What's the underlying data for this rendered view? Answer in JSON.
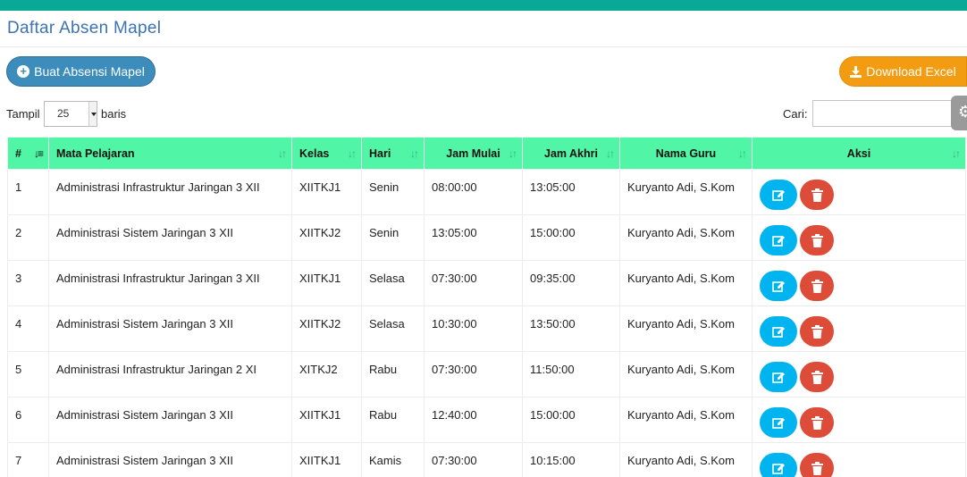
{
  "page": {
    "title": "Daftar Absen Mapel"
  },
  "toolbar": {
    "create_label": "Buat Absensi Mapel",
    "excel_label": "Download Excel",
    "accent": "#3c8dbc",
    "excel_color": "#f39c12",
    "header_bar_color": "#0aa896"
  },
  "table_controls": {
    "length_prefix": "Tampil",
    "length_value": "25",
    "length_suffix": "baris",
    "search_label": "Cari:",
    "search_value": ""
  },
  "table": {
    "header_color": "#50f5a6",
    "columns": [
      "#",
      "Mata Pelajaran",
      "Kelas",
      "Hari",
      "Jam Mulai",
      "Jam Akhri",
      "Nama Guru",
      "Aksi"
    ],
    "rows": [
      [
        "1",
        "Administrasi Infrastruktur Jaringan 3 XII",
        "XIITKJ1",
        "Senin",
        "08:00:00",
        "13:05:00",
        "Kuryanto Adi, S.Kom"
      ],
      [
        "2",
        "Administrasi Sistem Jaringan 3 XII",
        "XIITKJ2",
        "Senin",
        "13:05:00",
        "15:00:00",
        "Kuryanto Adi, S.Kom"
      ],
      [
        "3",
        "Administrasi Infrastruktur Jaringan 3 XII",
        "XIITKJ1",
        "Selasa",
        "07:30:00",
        "09:35:00",
        "Kuryanto Adi, S.Kom"
      ],
      [
        "4",
        "Administrasi Sistem Jaringan 3 XII",
        "XIITKJ2",
        "Selasa",
        "10:30:00",
        "13:50:00",
        "Kuryanto Adi, S.Kom"
      ],
      [
        "5",
        "Administrasi Infrastruktur Jaringan 2 XI",
        "XITKJ2",
        "Rabu",
        "07:30:00",
        "11:50:00",
        "Kuryanto Adi, S.Kom"
      ],
      [
        "6",
        "Administrasi Sistem Jaringan 3 XII",
        "XIITKJ1",
        "Rabu",
        "12:40:00",
        "15:00:00",
        "Kuryanto Adi, S.Kom"
      ],
      [
        "7",
        "Administrasi Sistem Jaringan 3 XII",
        "XIITKJ1",
        "Kamis",
        "07:30:00",
        "10:15:00",
        "Kuryanto Adi, S.Kom"
      ]
    ]
  },
  "icons": {
    "create": "plus-circle-icon",
    "excel": "download-icon",
    "edit": "edit-icon",
    "delete": "trash-icon",
    "sort": "sort-icon",
    "settings": "gear-icon"
  }
}
